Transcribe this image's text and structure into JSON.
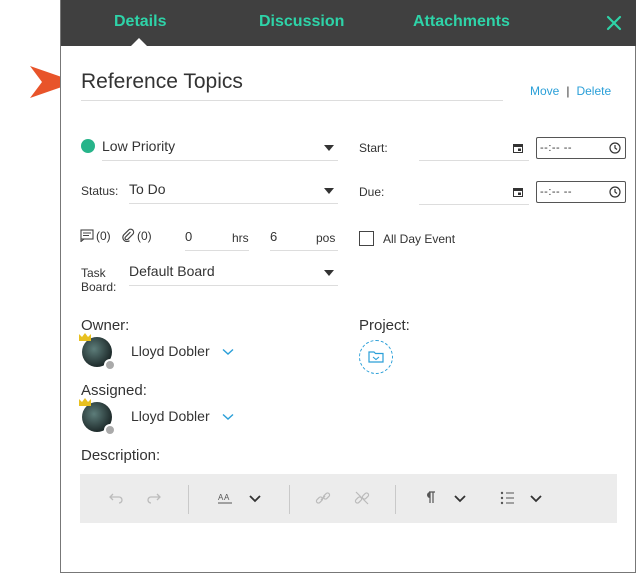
{
  "tabs": [
    {
      "label": "Details",
      "active": true
    },
    {
      "label": "Discussion",
      "active": false
    },
    {
      "label": "Attachments",
      "active": false
    }
  ],
  "colors": {
    "accent": "#2ed3a8",
    "tabbar": "#404040",
    "link": "#2a9fd8",
    "priority": "#27b48a",
    "pointer": "#e8542a"
  },
  "icons": [
    "close-icon",
    "calendar-icon",
    "clock-icon",
    "comment-icon",
    "paperclip-icon",
    "crown-icon",
    "chevron-down-icon",
    "folder-icon",
    "undo-icon",
    "redo-icon",
    "font-size-icon",
    "link-icon",
    "unlink-icon",
    "paragraph-icon",
    "list-icon",
    "pointer-arrow-icon"
  ],
  "task": {
    "title": "Reference Topics",
    "move_label": "Move",
    "separator": "|",
    "delete_label": "Delete"
  },
  "priority": {
    "value": "Low Priority"
  },
  "status": {
    "label": "Status:",
    "value": "To Do"
  },
  "start": {
    "label": "Start:",
    "time": "--:-- --"
  },
  "due": {
    "label": "Due:",
    "time": "--:-- --"
  },
  "counts": {
    "comments": "(0)",
    "attachments": "(0)",
    "hours_value": "0",
    "hours_unit": "hrs",
    "position_value": "6",
    "position_unit": "pos"
  },
  "all_day": {
    "label": "All Day Event",
    "checked": false
  },
  "task_board": {
    "label_line1": "Task",
    "label_line2": "Board:",
    "value": "Default Board"
  },
  "owner": {
    "label": "Owner:",
    "name": "Lloyd Dobler"
  },
  "project": {
    "label": "Project:"
  },
  "assigned": {
    "label": "Assigned:",
    "name": "Lloyd Dobler"
  },
  "description": {
    "label": "Description:"
  }
}
